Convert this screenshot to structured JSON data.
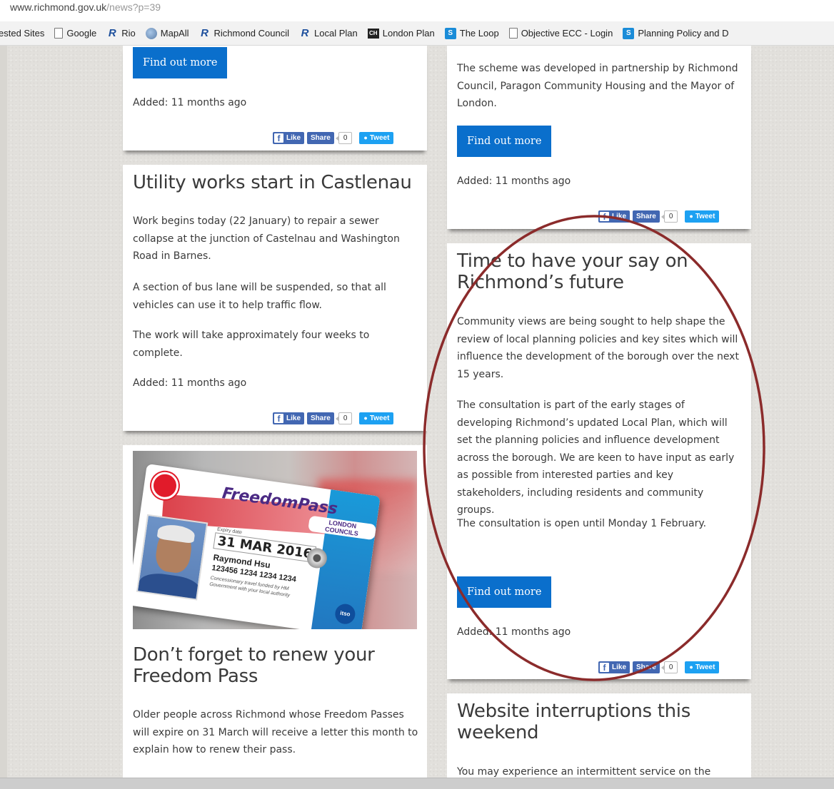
{
  "browser": {
    "url_main": "www.richmond.gov.uk",
    "url_rest": "/news?p=39",
    "bookmarks": [
      {
        "label": "ested Sites",
        "icon": "none"
      },
      {
        "label": "Google",
        "icon": "page-icon"
      },
      {
        "label": "Rio",
        "icon": "richmond-logo-icon"
      },
      {
        "label": "MapAll",
        "icon": "globe-icon"
      },
      {
        "label": "Richmond Council",
        "icon": "richmond-logo-icon"
      },
      {
        "label": "Local Plan",
        "icon": "richmond-logo-icon"
      },
      {
        "label": "London Plan",
        "icon": "ch-icon"
      },
      {
        "label": "The Loop",
        "icon": "sharepoint-icon"
      },
      {
        "label": "Objective ECC - Login",
        "icon": "page-icon"
      },
      {
        "label": "Planning Policy and D",
        "icon": "sharepoint-icon"
      }
    ]
  },
  "social": {
    "like": "Like",
    "share": "Share",
    "count": "0",
    "tweet": "Tweet"
  },
  "cards": {
    "top_left": {
      "button": "Find out more",
      "added": "Added: 11 months ago"
    },
    "utility": {
      "title": "Utility works start in Castlenau",
      "paragraphs": [
        "Work begins today (22 January) to repair a sewer collapse at the junction of Castelnau and Washington Road in Barnes.",
        "A section of bus lane will be suspended, so that all vehicles can use it to help traffic flow.",
        "The work will take approximately four weeks to complete."
      ],
      "added": "Added: 11 months ago"
    },
    "freedom": {
      "image": {
        "brand": "FreedomPass",
        "sub": "LONDON COUNCILS",
        "expiry_label": "Expiry date",
        "expiry": "31 MAR 2016",
        "name": "Raymond Hsu",
        "number": "123456 1234 1234 1234",
        "fine": "Concessionary travel funded by HM Government with your local authority",
        "itso": "itso"
      },
      "title": "Don’t forget to renew your Freedom Pass",
      "paragraphs": [
        "Older people across Richmond whose Freedom Passes will expire on 31 March will receive a letter this month to explain how to renew their pass."
      ]
    },
    "top_right": {
      "paragraph": "The scheme was developed in partnership by Richmond Council, Paragon Community Housing and the Mayor of London.",
      "button": "Find out more",
      "added": "Added: 11 months ago"
    },
    "future": {
      "title": "Time to have your say on Richmond’s future",
      "paragraphs": [
        "Community views are being sought to help shape the review of local planning policies and key sites which will influence the development of the borough over the next 15 years.",
        "The consultation is part of the early stages of developing Richmond’s updated Local Plan, which will set the planning policies and influence development across the borough. We are keen to have input as early as possible from interested parties and key stakeholders, including residents and community groups.",
        "The consultation is open until Monday 1 February."
      ],
      "button": "Find out more",
      "added": "Added: 11 months ago"
    },
    "website": {
      "title": "Website interruptions this weekend",
      "paragraph": "You may experience an intermittent service on the"
    }
  },
  "colors": {
    "button": "#0a6fcc",
    "annotation": "#8b2b2b",
    "facebook": "#4267b2",
    "twitter": "#1da1f2"
  }
}
